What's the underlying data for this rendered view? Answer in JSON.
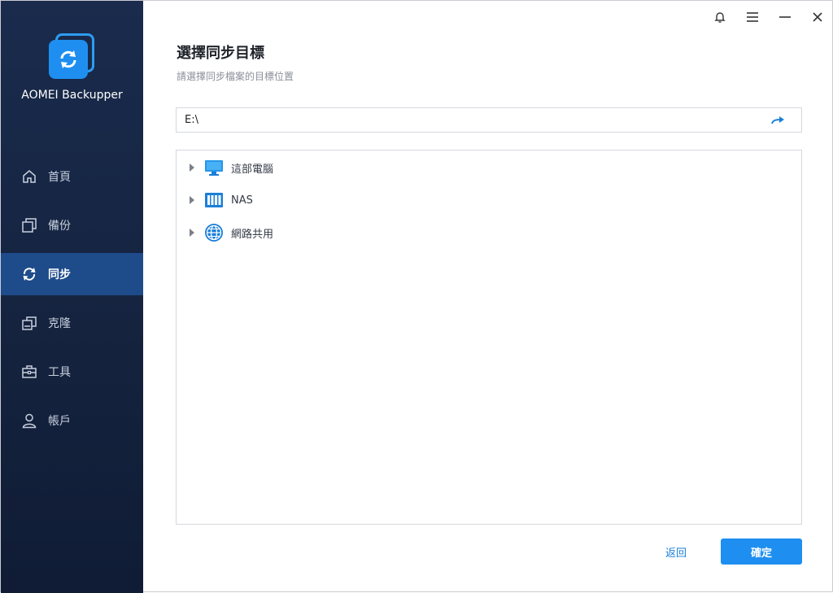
{
  "app": {
    "name": "AOMEI Backupper"
  },
  "sidebar": {
    "items": [
      {
        "label": "首頁",
        "icon": "home-icon"
      },
      {
        "label": "備份",
        "icon": "backup-icon"
      },
      {
        "label": "同步",
        "icon": "sync-icon",
        "active": true
      },
      {
        "label": "克隆",
        "icon": "clone-icon"
      },
      {
        "label": "工具",
        "icon": "toolbox-icon"
      },
      {
        "label": "帳戶",
        "icon": "user-icon"
      }
    ]
  },
  "titlebar": {
    "icons": [
      "bell-icon",
      "menu-icon",
      "minimize-icon",
      "close-icon"
    ]
  },
  "main": {
    "title": "選擇同步目標",
    "subtitle": "請選擇同步檔案的目標位置",
    "path": {
      "value": "E:\\"
    },
    "tree": [
      {
        "label": "這部電腦",
        "icon": "computer-icon"
      },
      {
        "label": "NAS",
        "icon": "nas-icon"
      },
      {
        "label": "網路共用",
        "icon": "globe-icon"
      }
    ],
    "back_label": "返回",
    "ok_label": "確定"
  },
  "colors": {
    "accent": "#1e8ff0",
    "sidebar": "#15233f",
    "active_nav": "#1e4b8a"
  }
}
